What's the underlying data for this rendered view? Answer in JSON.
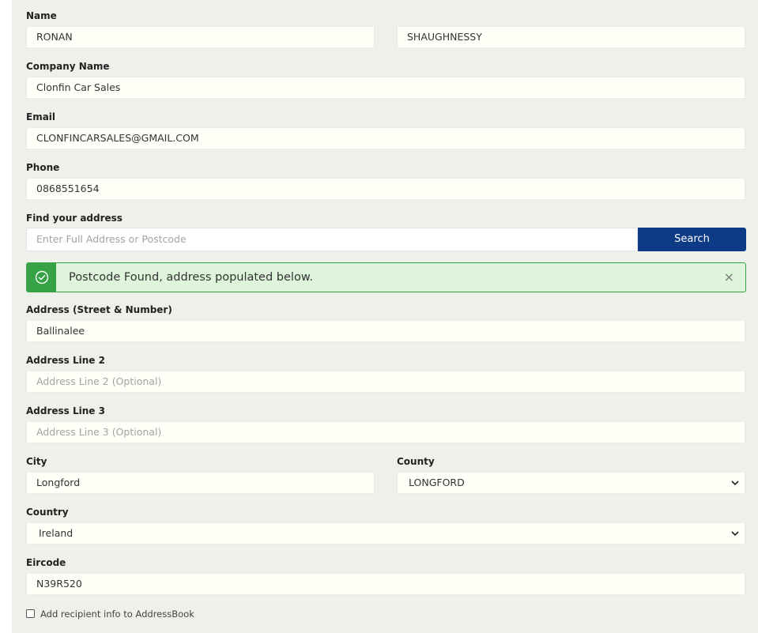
{
  "name": {
    "label": "Name",
    "first_value": "RONAN",
    "last_value": "SHAUGHNESSY"
  },
  "company": {
    "label": "Company Name",
    "value": "Clonfin Car Sales"
  },
  "email": {
    "label": "Email",
    "value": "CLONFINCARSALES@GMAIL.COM"
  },
  "phone": {
    "label": "Phone",
    "value": "0868551654"
  },
  "find_address": {
    "label": "Find your address",
    "placeholder": "Enter Full Address or Postcode",
    "button_label": "Search"
  },
  "alert": {
    "message": "Postcode Found, address populated below.",
    "close_symbol": "×",
    "icon": "check-circle-icon",
    "color": "#36a245"
  },
  "address1": {
    "label": "Address (Street & Number)",
    "value": "Ballinalee"
  },
  "address2": {
    "label": "Address Line 2",
    "placeholder": "Address Line 2 (Optional)"
  },
  "address3": {
    "label": "Address Line 3",
    "placeholder": "Address Line 3 (Optional)"
  },
  "city": {
    "label": "City",
    "value": "Longford"
  },
  "county": {
    "label": "County",
    "value": "LONGFORD"
  },
  "country": {
    "label": "Country",
    "value": "Ireland"
  },
  "eircode": {
    "label": "Eircode",
    "value": "N39R520"
  },
  "addressbook": {
    "label": "Add recipient info to AddressBook",
    "checked": false
  },
  "colors": {
    "primary_button": "#0d3b86",
    "panel_bg": "#eef0ea",
    "field_bg": "#fffff7"
  }
}
